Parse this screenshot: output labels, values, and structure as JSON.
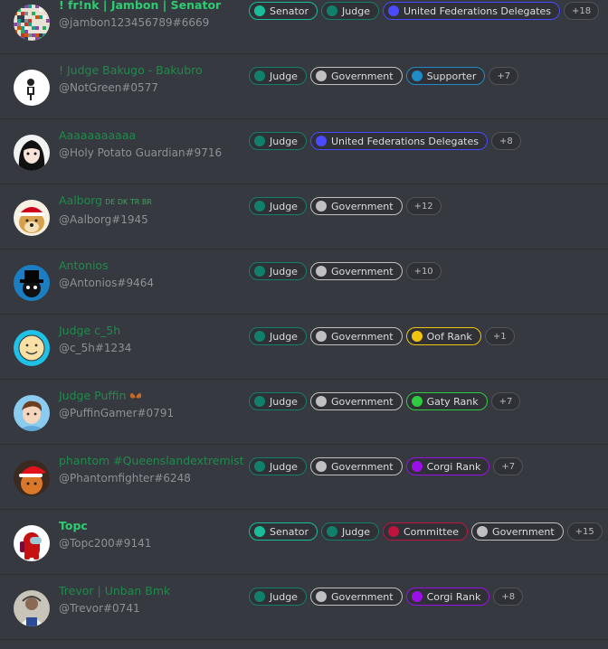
{
  "colors": {
    "background": "#36393f",
    "senator": "#1abc9c",
    "judge": "#11806a",
    "government": "#c0c0c0",
    "ufd": "#4a4aff",
    "supporter": "#1f8bc8",
    "oof_rank": "#f1c40f",
    "gaty_rank": "#2ecc40",
    "corgi_rank": "#9b10e8",
    "committee": "#c0143c",
    "name_green": "#2ecc71",
    "name_dark_green": "#1f8b4c"
  },
  "members": [
    {
      "display_name": "! fr!nk | Jambon | Senator",
      "tag": "@jambon123456789#6669",
      "name_color": "#2ecc71",
      "bold": true,
      "avatar_icon": "pixel-art-avatar-icon",
      "roles": [
        {
          "label": "Senator",
          "color": "#1abc9c"
        },
        {
          "label": "Judge",
          "color": "#11806a"
        },
        {
          "label": "United Federations Delegates",
          "color": "#4a4aff"
        }
      ],
      "more": "+18"
    },
    {
      "display_name": "! Judge Bakugo - Bakubro",
      "tag": "@NotGreen#0577",
      "name_color": "#1f8b4c",
      "bold": false,
      "avatar_icon": "white-figure-avatar-icon",
      "roles": [
        {
          "label": "Judge",
          "color": "#11806a"
        },
        {
          "label": "Government",
          "color": "#c0c0c0"
        },
        {
          "label": "Supporter",
          "color": "#1f8bc8"
        }
      ],
      "more": "+7"
    },
    {
      "display_name": "Aaaaaaaaaaa",
      "tag": "@Holy Potato Guardian#9716",
      "name_color": "#1f8b4c",
      "bold": false,
      "avatar_icon": "anime-character-avatar-icon",
      "roles": [
        {
          "label": "Judge",
          "color": "#11806a"
        },
        {
          "label": "United Federations Delegates",
          "color": "#4a4aff"
        }
      ],
      "more": "+8"
    },
    {
      "display_name": "Aalborg",
      "flags": "DE DK TR BR",
      "tag": "@Aalborg#1945",
      "name_color": "#1f8b4c",
      "bold": false,
      "avatar_icon": "doge-santa-avatar-icon",
      "roles": [
        {
          "label": "Judge",
          "color": "#11806a"
        },
        {
          "label": "Government",
          "color": "#c0c0c0"
        }
      ],
      "more": "+12"
    },
    {
      "display_name": "Antonios",
      "tag": "@Antonios#9464",
      "name_color": "#1f8b4c",
      "bold": false,
      "avatar_icon": "top-hat-avatar-icon",
      "roles": [
        {
          "label": "Judge",
          "color": "#11806a"
        },
        {
          "label": "Government",
          "color": "#c0c0c0"
        }
      ],
      "more": "+10"
    },
    {
      "display_name": "Judge c_5h",
      "tag": "@c_5h#1234",
      "name_color": "#1f8b4c",
      "bold": false,
      "avatar_icon": "smiley-face-avatar-icon",
      "roles": [
        {
          "label": "Judge",
          "color": "#11806a"
        },
        {
          "label": "Government",
          "color": "#c0c0c0"
        },
        {
          "label": "Oof Rank",
          "color": "#f1c40f"
        }
      ],
      "more": "+1"
    },
    {
      "display_name": "Judge Puffin",
      "tag": "@PuffinGamer#0791",
      "name_color": "#1f8b4c",
      "bold": false,
      "has_emoji": true,
      "avatar_icon": "cartoon-boy-avatar-icon",
      "roles": [
        {
          "label": "Judge",
          "color": "#11806a"
        },
        {
          "label": "Government",
          "color": "#c0c0c0"
        },
        {
          "label": "Gaty Rank",
          "color": "#2ecc40"
        }
      ],
      "more": "+7"
    },
    {
      "display_name": "phantom #Queenslandextremist",
      "tag": "@Phantomfighter#6248",
      "name_color": "#1f8b4c",
      "bold": false,
      "avatar_icon": "santa-hat-avatar-icon",
      "roles": [
        {
          "label": "Judge",
          "color": "#11806a"
        },
        {
          "label": "Government",
          "color": "#c0c0c0"
        },
        {
          "label": "Corgi Rank",
          "color": "#9b10e8"
        }
      ],
      "more": "+7"
    },
    {
      "display_name": "Topc",
      "tag": "@Topc200#9141",
      "name_color": "#2ecc71",
      "bold": true,
      "avatar_icon": "red-crewmate-avatar-icon",
      "roles": [
        {
          "label": "Senator",
          "color": "#1abc9c"
        },
        {
          "label": "Judge",
          "color": "#11806a"
        },
        {
          "label": "Committee",
          "color": "#c0143c"
        },
        {
          "label": "Government",
          "color": "#c0c0c0"
        }
      ],
      "more": "+15"
    },
    {
      "display_name": "Trevor | Unban Bmk",
      "tag": "@Trevor#0741",
      "name_color": "#1f8b4c",
      "bold": false,
      "avatar_icon": "photo-avatar-icon",
      "roles": [
        {
          "label": "Judge",
          "color": "#11806a"
        },
        {
          "label": "Government",
          "color": "#c0c0c0"
        },
        {
          "label": "Corgi Rank",
          "color": "#9b10e8"
        }
      ],
      "more": "+8"
    }
  ]
}
